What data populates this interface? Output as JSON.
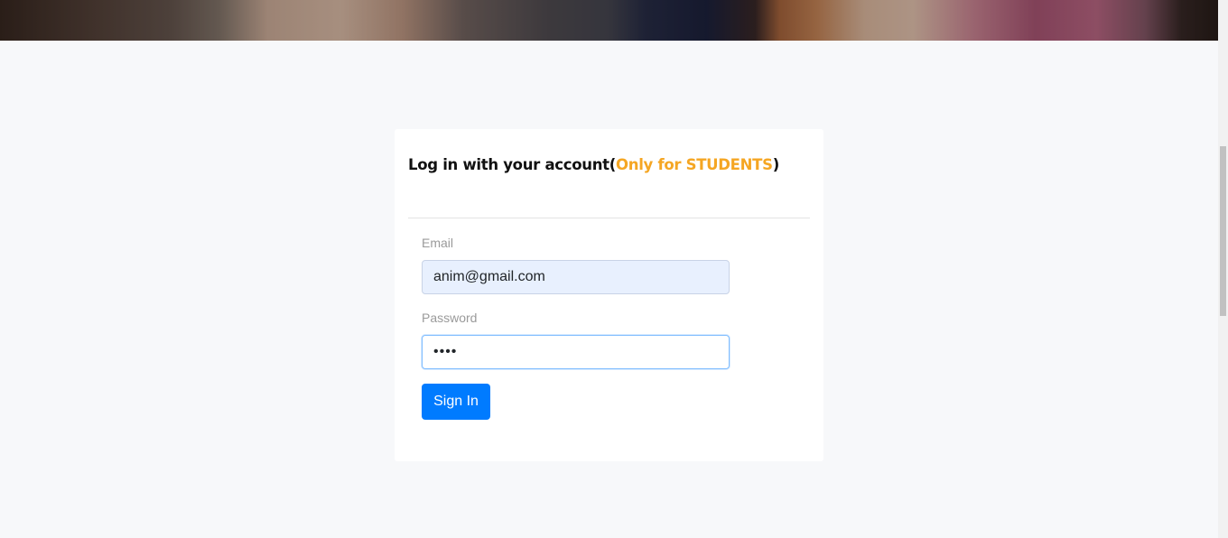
{
  "login": {
    "title_prefix": "Log in with your account(",
    "title_highlight": "Only for STUDENTS",
    "title_suffix": ")",
    "highlight_color": "#f5a623",
    "email_label": "Email",
    "email_value": "anim@gmail.com",
    "password_label": "Password",
    "password_value": "••••",
    "signin_label": "Sign In",
    "button_color": "#007bff"
  }
}
